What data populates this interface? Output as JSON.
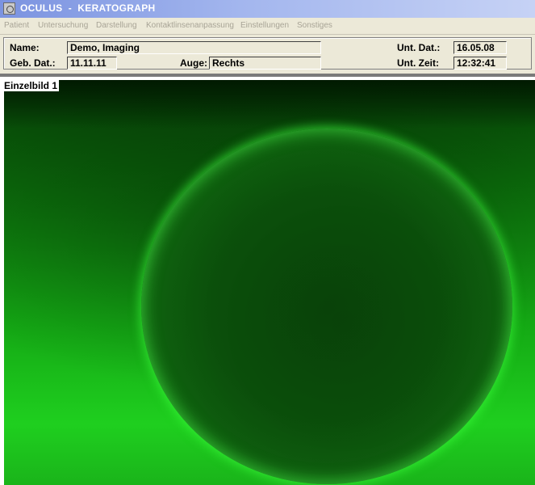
{
  "window": {
    "title": "OCULUS  -  KERATOGRAPH"
  },
  "menu": [
    "Patient",
    "Untersuchung",
    "Darstellung",
    "Kontaktlinsenanpassung",
    "Einstellungen",
    "Sonstiges"
  ],
  "patient": {
    "name_label": "Name:",
    "name": "Demo, Imaging",
    "dob_label": "Geb. Dat.:",
    "dob": "11.11.11",
    "eye_label": "Auge:",
    "eye": "Rechts",
    "exam_date_label": "Unt. Dat.:",
    "exam_date": "16.05.08",
    "exam_time_label": "Unt. Zeit:",
    "exam_time": "12:32:41"
  },
  "viewer": {
    "frame_label": "Einzelbild 1"
  },
  "colors": {
    "accent_green": "#39ff39",
    "titlebar_blue": "#7b93e0"
  }
}
